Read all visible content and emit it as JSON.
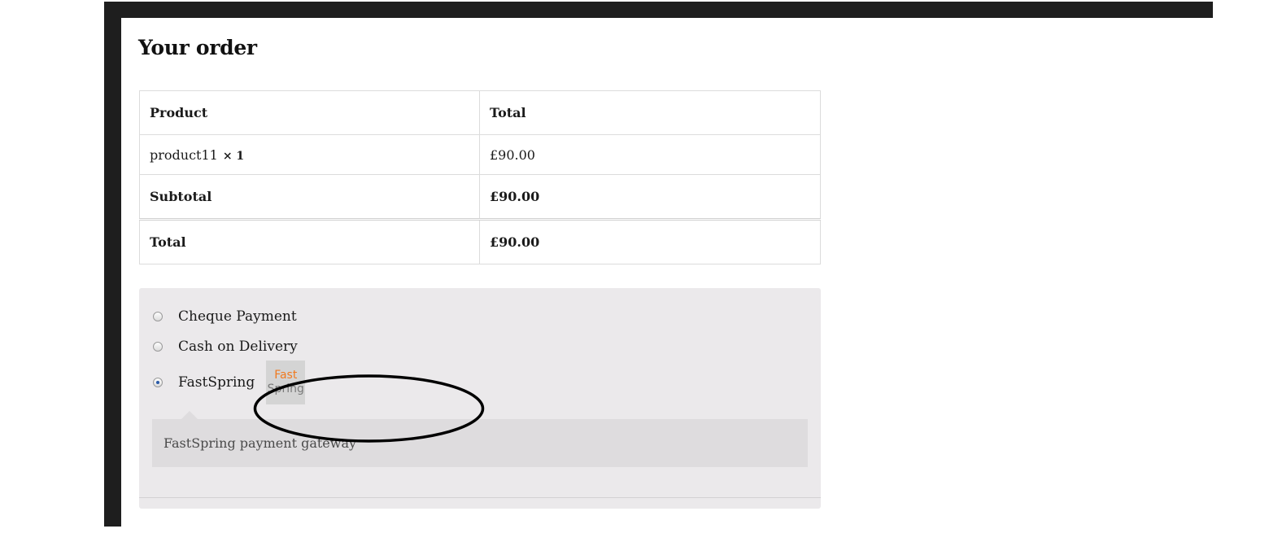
{
  "order": {
    "title": "Your order",
    "headers": {
      "product": "Product",
      "total": "Total"
    },
    "item": {
      "name": "product11",
      "qty": "× 1",
      "price": "£90.00"
    },
    "subtotal": {
      "label": "Subtotal",
      "value": "£90.00"
    },
    "total": {
      "label": "Total",
      "value": "£90.00"
    }
  },
  "payment": {
    "methods": [
      {
        "label": "Cheque Payment",
        "selected": false
      },
      {
        "label": "Cash on Delivery",
        "selected": false
      },
      {
        "label": "FastSpring",
        "selected": true
      }
    ],
    "logo": {
      "line1": "Fast",
      "line2": "Spring",
      "color_primary": "#f07a20",
      "color_secondary": "#7a7a7a"
    },
    "description": "FastSpring payment gateway"
  },
  "annotation": {
    "shape": "ellipse",
    "color": "#000000"
  }
}
